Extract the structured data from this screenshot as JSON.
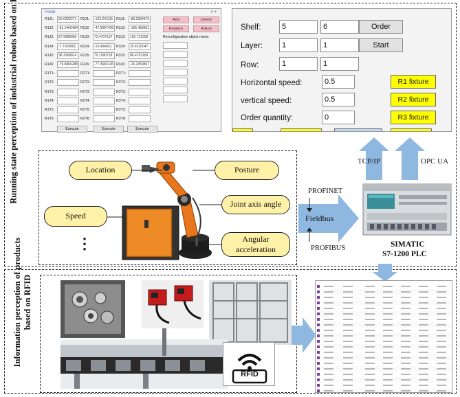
{
  "side_labels": {
    "top": "Running state perception of industrial robots based on PLC",
    "bottom": "Information perception of products based on RFID"
  },
  "panel": {
    "title": "Panel",
    "close": "× ×",
    "rows": [
      {
        "l1": "R1J1:",
        "v1": "50.0202271",
        "l2": "R2J1:",
        "v2": "-122.242111",
        "l3": "R3J1:",
        "v3": "-80.0384979"
      },
      {
        "l1": "R1J2:",
        "v1": "-81.1460494",
        "l2": "R2J2:",
        "v2": "-47.5097408",
        "l3": "R3J2:",
        "v3": "-105.458301"
      },
      {
        "l1": "R1J3:",
        "v1": "87.9288950",
        "l2": "R2J3:",
        "v2": "73.4707107",
        "l3": "R3J3:",
        "v3": "100.731556"
      },
      {
        "l1": "R1J4:",
        "v1": "-7.7109801",
        "l2": "R2J4:",
        "v2": "-16.434651",
        "l3": "R3J4:",
        "v3": "20.4120047"
      },
      {
        "l1": "R1J5:",
        "v1": "38.3268814",
        "l2": "R2J5:",
        "v2": "79.1590728",
        "l3": "R3J5:",
        "v3": "86.4753189"
      },
      {
        "l1": "R1J6:",
        "v1": "-79.8806288",
        "l2": "R2J6:",
        "v2": "-77.3583145",
        "l3": "R3J6:",
        "v3": "-26.2359867"
      },
      {
        "l1": "R1T1:",
        "v1": "",
        "l2": "R2T1:",
        "v2": "",
        "l3": "R3T1:",
        "v3": ""
      },
      {
        "l1": "R1T2:",
        "v1": "",
        "l2": "R2T2:",
        "v2": "",
        "l3": "R3T2:",
        "v3": ""
      },
      {
        "l1": "R1T3:",
        "v1": "",
        "l2": "R2T3:",
        "v2": "",
        "l3": "R3T3:",
        "v3": ""
      },
      {
        "l1": "R1T4:",
        "v1": "",
        "l2": "R2T4:",
        "v2": "",
        "l3": "R3T4:",
        "v3": ""
      },
      {
        "l1": "R1T5:",
        "v1": "",
        "l2": "R2T5:",
        "v2": "",
        "l3": "R3T5:",
        "v3": ""
      },
      {
        "l1": "R1T6:",
        "v1": "",
        "l2": "R2T6:",
        "v2": "",
        "l3": "R3T6:",
        "v3": ""
      }
    ],
    "execute": "Execute",
    "add": "Add",
    "delete": "Delete",
    "replace": "Replace",
    "adjust": "Adjust",
    "reconfig_label": "Reconfiguration object name:"
  },
  "control": {
    "shelf_label": "Shelf:",
    "shelf_a": "5",
    "shelf_b": "6",
    "order_btn": "Order",
    "layer_label": "Layer:",
    "layer_a": "1",
    "layer_b": "1",
    "start_btn": "Start",
    "row_label": "Row:",
    "row_a": "1",
    "row_b": "1",
    "hspeed_label": "Horizontal speed:",
    "hspeed": "0.5",
    "vspeed_label": "vertical speed:",
    "vspeed": "0.5",
    "qty_label": "Order quantity:",
    "qty": "0",
    "r1": "R1 fixture",
    "r2": "R2 fixture",
    "r3": "R3 fixture"
  },
  "robot_bubbles": {
    "location": "Location",
    "posture": "Posture",
    "joint": "Joint axis angle",
    "speed": "Speed",
    "angular_1": "Angular",
    "angular_2": "acceleration",
    "ellipsis": "⋮"
  },
  "network": {
    "profinet": "PROFINET",
    "fieldbus": "Fieldbus",
    "profibus": "PROFIBUS",
    "tcpip": "TCP/IP",
    "opcua": "OPC UA",
    "plc_name_1": "SIMATIC",
    "plc_name_2": "S7-1200 PLC"
  },
  "rfid": {
    "label": "RFID"
  },
  "colors": {
    "arrow": "#8fb8e0",
    "bubble": "#fff2a8",
    "yellow_button": "#ffff00",
    "pink_button": "#f4c0c8",
    "robot_orange": "#e8761e"
  }
}
